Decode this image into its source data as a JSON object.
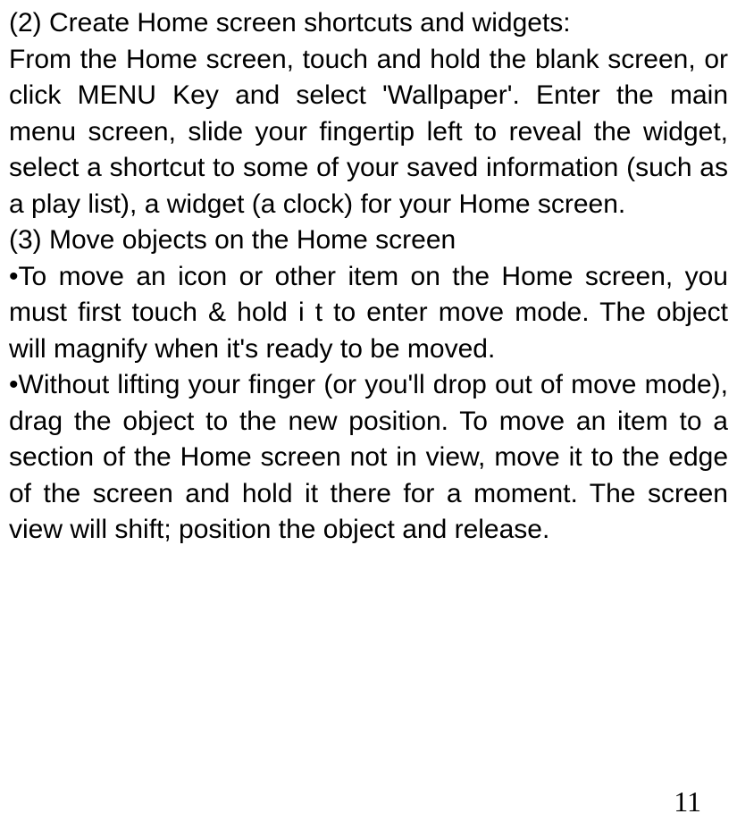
{
  "sections": {
    "section2": {
      "heading": "(2) Create Home screen shortcuts and widgets:",
      "body": "From the Home screen, touch and hold the blank screen, or click MENU Key and select 'Wallpaper'. Enter the main menu screen, slide your fingertip left to reveal the widget, select a shortcut to some of your saved information (such as a play list), a widget (a clock) for your Home screen."
    },
    "section3": {
      "heading": "(3) Move objects on the Home screen",
      "bullet1": "•To move an icon or other item on the Home screen, you must first touch & hold i t to enter move mode. The object will magnify when it's ready to be moved.",
      "bullet2": "•Without lifting your finger (or you'll drop out of move mode), drag the object to the new position. To move an item to a section of the Home screen not in view, move it to the edge of the screen and hold it there for a moment. The screen view will shift; position the object and release."
    }
  },
  "page_number": "11"
}
